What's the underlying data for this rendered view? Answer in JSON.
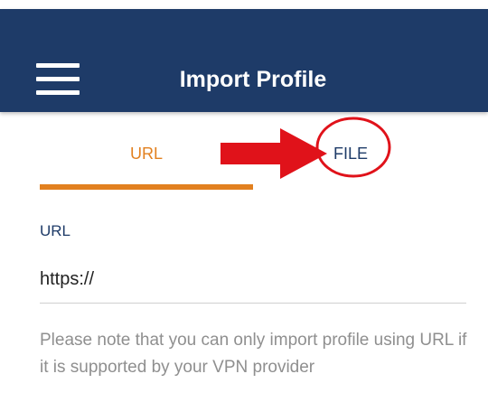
{
  "header": {
    "title": "Import Profile",
    "menu_icon": "hamburger-menu-icon",
    "background_color": "#1e3b68"
  },
  "tabs": [
    {
      "label": "URL",
      "selected": true,
      "color": "#e2801f"
    },
    {
      "label": "FILE",
      "selected": false,
      "color": "#1e3b68"
    }
  ],
  "annotations": {
    "arrow_icon": "red-arrow-icon",
    "circle_icon": "red-circle-highlight-icon",
    "color": "#e0121a"
  },
  "form": {
    "url_label": "URL",
    "url_value": "https://"
  },
  "note": "Please note that you can only import profile using URL if it is supported by your VPN provider"
}
